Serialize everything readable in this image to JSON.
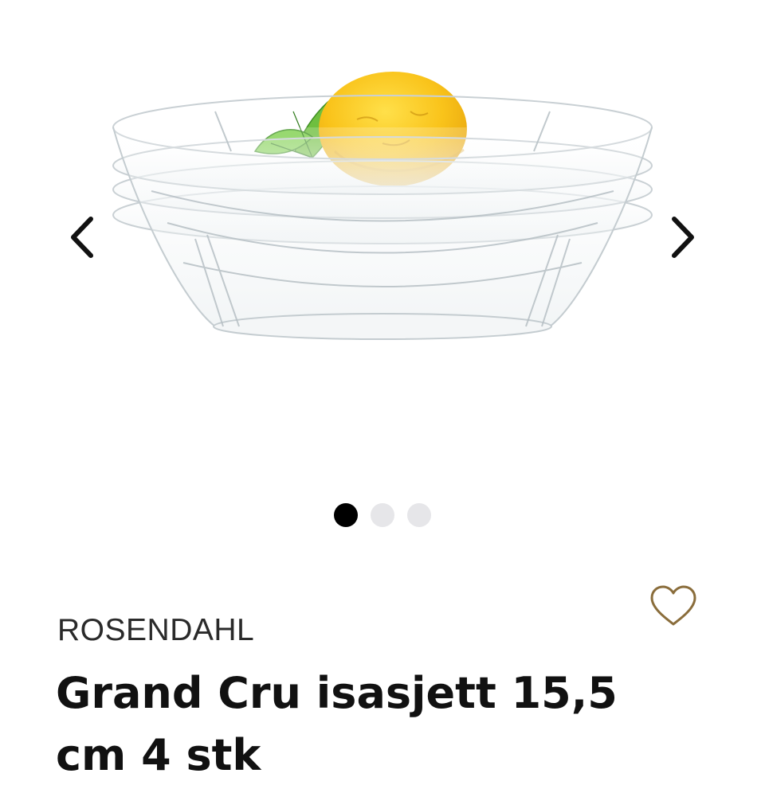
{
  "carousel": {
    "image_alt": "Grand Cru isasjett 15,5 cm 4 stk",
    "image_count": 3,
    "active_index": 0,
    "prev_icon": "chevron-left-icon",
    "next_icon": "chevron-right-icon"
  },
  "wishlist": {
    "icon": "heart-outline-icon",
    "color": "#8a6d3b"
  },
  "product": {
    "brand": "ROSENDAHL",
    "title": "Grand Cru isasjett 15,5 cm 4 stk"
  }
}
